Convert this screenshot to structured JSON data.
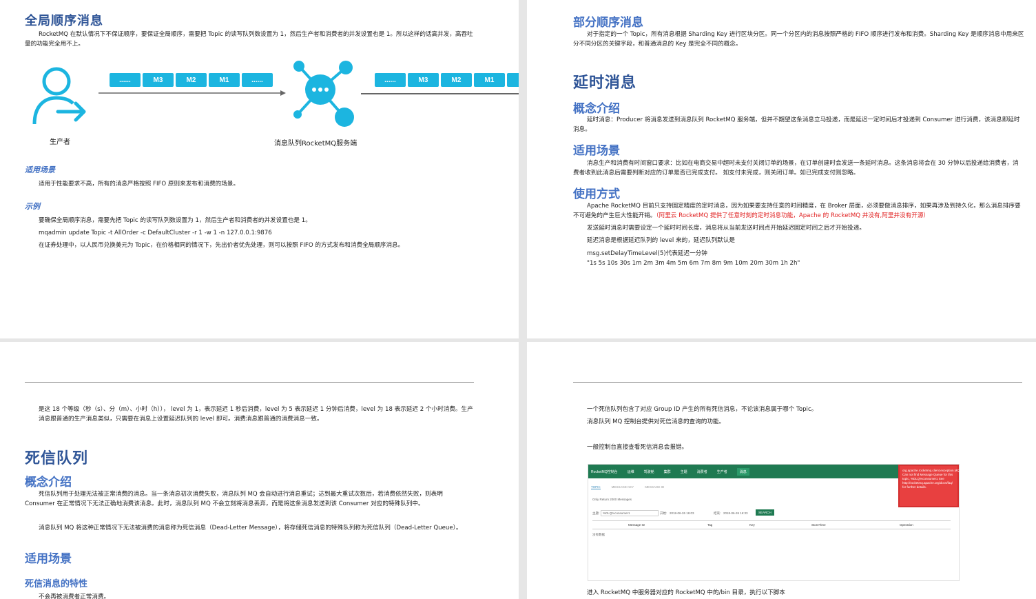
{
  "p1": {
    "heading": "全局顺序消息",
    "intro": "RocketMQ 在默认情况下不保证顺序，要保证全局顺序，需要把 Topic 的读写队列数设置为 1，然后生产者和消费者的并发设置也是 1。所以这样的话高并发，高吞吐量的功能完全用不上。",
    "queue_left": [
      "......",
      "M3",
      "M2",
      "M1",
      "......"
    ],
    "queue_right": [
      "......",
      "M3",
      "M2",
      "M1",
      ""
    ],
    "producer_label": "生产者",
    "server_label": "消息队列RocketMQ服务端",
    "scene_heading": "适用场景",
    "scene_text": "适用于性能要求不高，所有的消息严格按照 FIFO 原则来发布和消费的场景。",
    "example_heading": "示例",
    "example_lines": [
      "要确保全局顺序消息，需要先把 Topic 的读写队列数设置为 1，然后生产者和消费者的并发设置也是 1。",
      "mqadmin update Topic -t AllOrder -c DefaultCluster -r 1 -w 1 -n 127.0.0.1:9876",
      "在证券处理中，以人民币兑换美元为 Topic，在价格相同的情况下，先出价者优先处理，则可以按照 FIFO 的方式发布和消费全局顺序消息。"
    ]
  },
  "p2": {
    "heading": "部分顺序消息",
    "intro": "对于指定的一个 Topic，所有消息根据 Sharding Key 进行区块分区。同一个分区内的消息按照严格的 FIFO 顺序进行发布和消费。Sharding Key 是顺序消息中用来区分不同分区的关键字段，和普通消息的 Key 是完全不同的概念。",
    "delay_heading": "延时消息",
    "concept_heading": "概念介绍",
    "concept_text": "延时消息：Producer 将消息发送到消息队列 RocketMQ 服务端，但并不期望这条消息立马投递，而是延迟一定时间后才投递到 Consumer 进行消费，该消息即延时消息。",
    "scene_heading": "适用场景",
    "scene_text": "消息生产和消费有时间窗口要求：比如在电商交易中超时未支付关闭订单的场景，在订单创建时会发送一条延时消息。这条消息将会在 30 分钟以后投递给消费者，消费者收到此消息后需要判断对应的订单是否已完成支付。 如支付未完成，则关闭订单。如已完成支付则忽略。",
    "usage_heading": "使用方式",
    "usage_text": "Apache RocketMQ 目前只支持固定精度的定时消息，因为如果要支持任意的时间精度，在 Broker 层面，必须要做消息排序，如果再涉及到持久化，那么消息排序要不可避免的产生巨大性能开销。",
    "usage_red": "（阿里云 RocketMQ 提供了任意时刻的定时消息功能，Apache 的 RocketMQ 并没有,阿里并没有开源）",
    "lines": [
      "发送延时消息时需要设定一个延时时间长度，消息将从当前发送时间点开始延迟固定时间之后才开始投递。",
      "延迟消息是根据延迟队列的 level 来的，延迟队列默认是",
      "msg.setDelayTimeLevel(5)代表延迟一分钟",
      "\"1s 5s 10s 30s 1m 2m 3m 4m 5m 6m 7m 8m 9m 10m 20m 30m 1h 2h\""
    ]
  },
  "p3": {
    "continuation": "是这 18 个等级（秒（s）、分（m）、小时（h））， level 为 1，表示延迟 1 秒后消费，level 为 5 表示延迟 1 分钟后消费，level 为 18 表示延迟 2 个小时消费。生产消息跟普通的生产消息类似，只需要在消息上设置延迟队列的 level 即可。消费消息跟普通的消费消息一致。",
    "heading": "死信队列",
    "concept_heading": "概念介绍",
    "concept_text": "死信队列用于处理无法被正常消费的消息。当一条消息初次消费失败，消息队列 MQ 会自动进行消息重试；达到最大重试次数后，若消费依然失败，则表明 Consumer 在正常情况下无法正确地消费该消息。此时，消息队列 MQ 不会立刻将消息丢弃，而是将这条消息发送到该 Consumer 对应的特殊队列中。",
    "concept_text2": "消息队列 MQ 将这种正常情况下无法被消费的消息称为死信消息（Dead-Letter Message），将存储死信消息的特殊队列称为死信队列（Dead-Letter Queue）。",
    "scene_heading": "适用场景",
    "feature_heading": "死信消息的特性",
    "feature_text": "不会再被消费者正常消费。"
  },
  "p4": {
    "line1": "一个死信队列包含了对应 Group ID 产生的所有死信消息，不论该消息属于哪个 Topic。",
    "line2": "消息队列 MQ 控制台提供对死信消息的查询的功能。",
    "line3": "一般控制台直接查看死信消息会报错。",
    "console": {
      "nav": [
        "RocketMQ控制台",
        "运维",
        "驾驶舱",
        "集群",
        "主题",
        "消费者",
        "生产者",
        "消息"
      ],
      "tabs": [
        "TOPIC",
        "MESSAGE KEY",
        "MESSAGE ID"
      ],
      "note": "Only Return 2000 Messages",
      "topic_label": "主题:",
      "topic_value": "%DLQ%consumer1",
      "start_label": "开始:",
      "start_value": "2018-06-26 16:03",
      "end_label": "结束:",
      "end_value": "2018-06-26 16:33",
      "search_btn": "SEARCH",
      "columns": [
        "Message ID",
        "Tag",
        "Key",
        "StoreTime",
        "Operation"
      ],
      "empty": "没有数据",
      "error": "org.apache.rocketmq.client.exception.MQ Can not find Message Queue for this topic, %DLQ%consumer1 See http://rocketmq.apache.org/docs/faq/ for further details."
    },
    "line4": "进入 RocketMQ 中服务器对应的 RocketMQ 中的/bin 目录，执行以下脚本"
  }
}
